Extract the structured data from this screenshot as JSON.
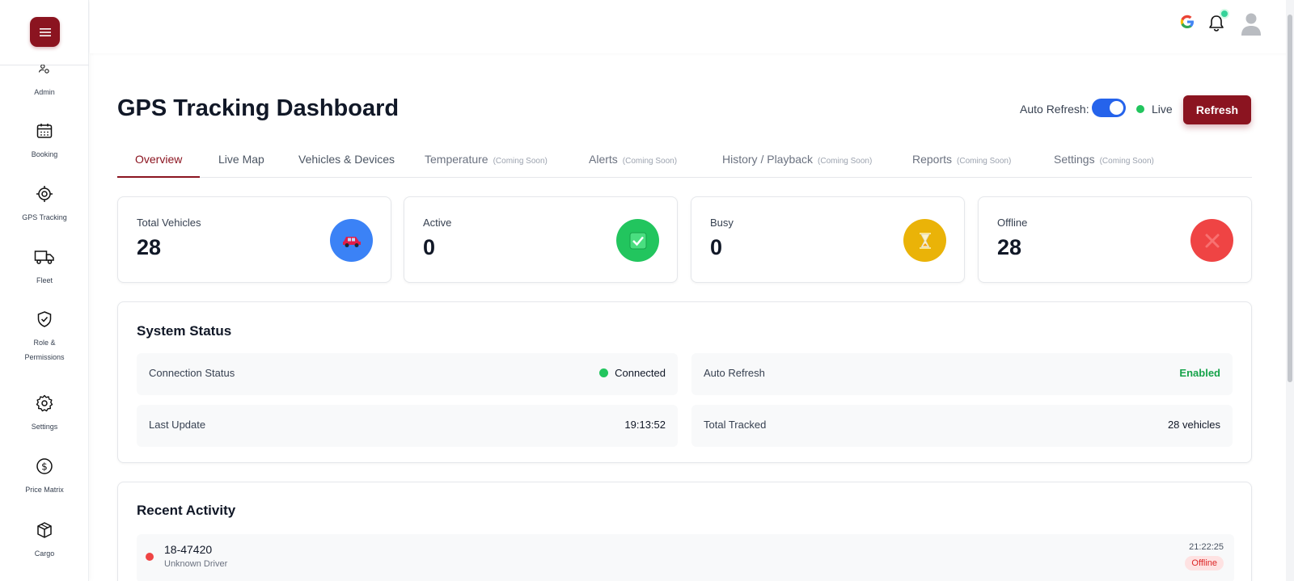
{
  "sidebar": {
    "items": [
      {
        "label": "Admin",
        "icon": "admin-icon"
      },
      {
        "label": "Booking",
        "icon": "calendar-icon"
      },
      {
        "label": "GPS Tracking",
        "icon": "target-icon"
      },
      {
        "label": "Fleet",
        "icon": "truck-icon"
      },
      {
        "label": "Role &",
        "label2": "Permissions",
        "icon": "shield-check-icon"
      },
      {
        "label": "Settings",
        "icon": "gear-icon"
      },
      {
        "label": "Price Matrix",
        "icon": "dollar-icon"
      },
      {
        "label": "Cargo",
        "icon": "box-icon"
      }
    ]
  },
  "header": {
    "title": "GPS Tracking Dashboard",
    "auto_refresh_label": "Auto Refresh:",
    "auto_refresh_on": true,
    "live_label": "Live",
    "refresh_button": "Refresh"
  },
  "tabs": [
    {
      "label": "Overview",
      "active": true
    },
    {
      "label": "Live Map"
    },
    {
      "label": "Vehicles & Devices"
    },
    {
      "label": "Temperature",
      "note": "(Coming Soon)"
    },
    {
      "label": "Alerts",
      "note": "(Coming Soon)"
    },
    {
      "label": "History / Playback",
      "note": "(Coming Soon)"
    },
    {
      "label": "Reports",
      "note": "(Coming Soon)"
    },
    {
      "label": "Settings",
      "note": "(Coming Soon)"
    }
  ],
  "stats": [
    {
      "label": "Total Vehicles",
      "value": "28",
      "icon": "car-icon",
      "color": "#3b82f6"
    },
    {
      "label": "Active",
      "value": "0",
      "icon": "check-icon",
      "color": "#22c55e"
    },
    {
      "label": "Busy",
      "value": "0",
      "icon": "hourglass-icon",
      "color": "#eab308"
    },
    {
      "label": "Offline",
      "value": "28",
      "icon": "x-icon",
      "color": "#ef4444"
    }
  ],
  "system_status": {
    "title": "System Status",
    "connection_status_label": "Connection Status",
    "connection_status_value": "Connected",
    "auto_refresh_label": "Auto Refresh",
    "auto_refresh_value": "Enabled",
    "last_update_label": "Last Update",
    "last_update_value": "19:13:52",
    "total_tracked_label": "Total Tracked",
    "total_tracked_value": "28 vehicles"
  },
  "recent_activity": {
    "title": "Recent Activity",
    "items": [
      {
        "id": "18-47420",
        "driver": "Unknown Driver",
        "time": "21:22:25",
        "status": "Offline"
      }
    ]
  },
  "colors": {
    "brand": "#8b1420",
    "toggle": "#2563eb",
    "live": "#22c55e"
  }
}
